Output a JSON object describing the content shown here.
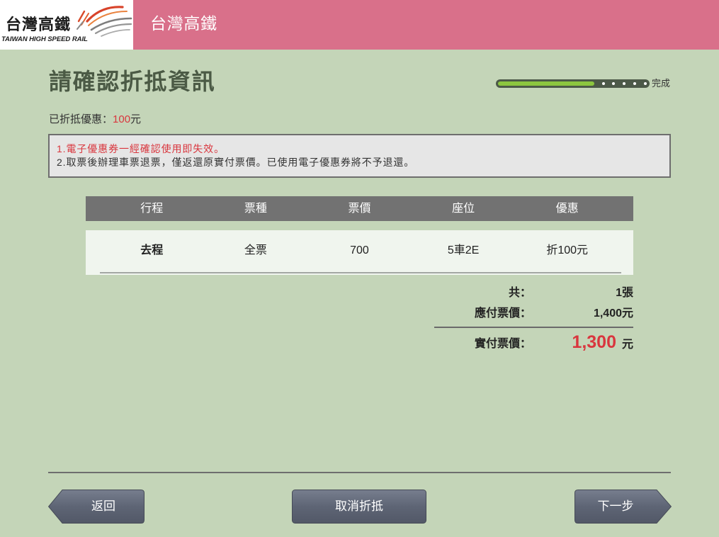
{
  "header": {
    "logo_text_cn": "台灣高鐵",
    "logo_text_en": "TAIWAN HIGH SPEED RAIL",
    "title": "台灣高鐵"
  },
  "page": {
    "title": "請確認折抵資訊",
    "progress": {
      "fraction": 0.64,
      "end_label": "完成"
    }
  },
  "discount": {
    "label": "已折抵優惠：",
    "amount": "100",
    "unit": "元"
  },
  "notice": {
    "lines": [
      "1.電子優惠券一經確認使用即失效。",
      "2.取票後辦理車票退票，僅返還原實付票價。已使用電子優惠券將不予退還。"
    ]
  },
  "trip_table": {
    "headers": [
      "行程",
      "票種",
      "票價",
      "座位",
      "優惠"
    ],
    "rows": [
      {
        "trip": "去程",
        "ticket_type": "全票",
        "price": "700",
        "seat": "5車2E",
        "discount": "折100元"
      }
    ]
  },
  "summary": {
    "count_label": "共：",
    "count_value": "1張",
    "payable_label": "應付票價：",
    "payable_value": "1,400元",
    "actual_label": "實付票價：",
    "actual_value": "1,300",
    "actual_unit": "元"
  },
  "buttons": {
    "back": "返回",
    "cancel": "取消折抵",
    "next": "下一步"
  },
  "colors": {
    "header_pink": "#D9708A",
    "background": "#C4D5B8",
    "title": "#4B5A45",
    "highlight_red": "#D9363E",
    "progress_green": "#8CC63F",
    "table_header": "#727272",
    "row_background": "#F0F5EE",
    "button": "#5E6575"
  }
}
